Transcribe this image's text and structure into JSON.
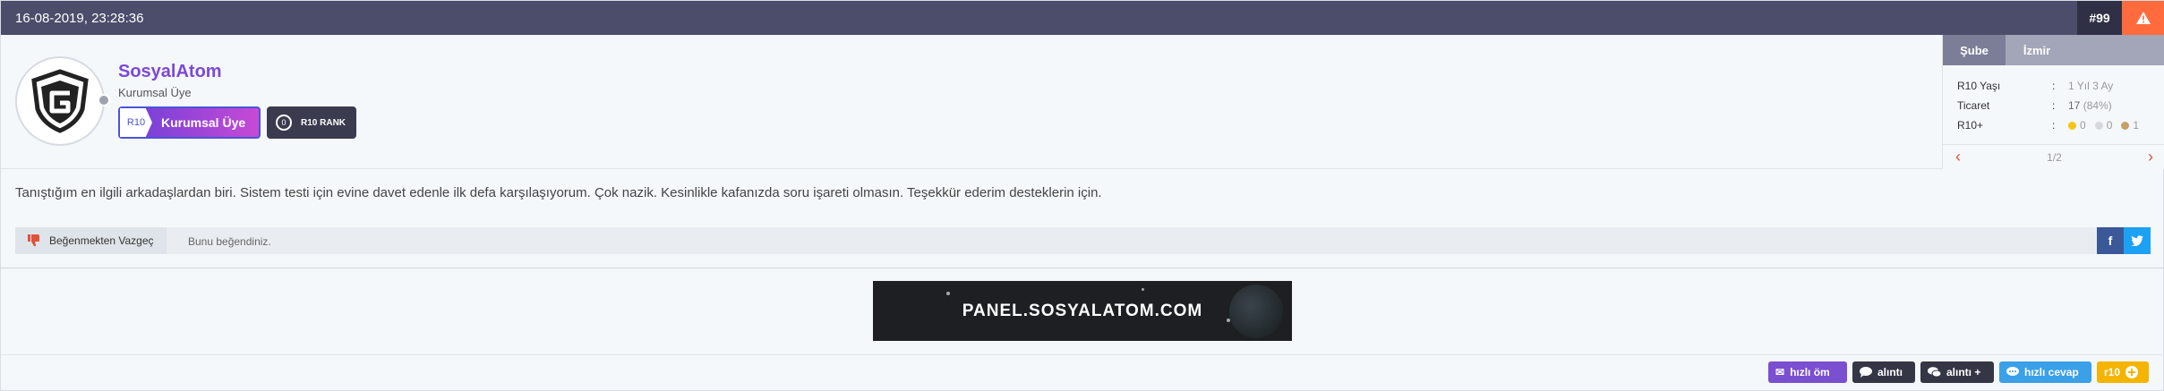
{
  "header": {
    "date": "16-08-2019, 23:28:36",
    "post_number": "#99",
    "report_icon": "warning-icon"
  },
  "user": {
    "name": "SosyalAtom",
    "title": "Kurumsal Üye",
    "badge_primary": {
      "tag": "R10",
      "label": "Kurumsal Üye"
    },
    "badge_rank": {
      "count": "0",
      "label": "R10 RANK"
    }
  },
  "side": {
    "tabs": [
      "Şube",
      "İzmir"
    ],
    "stats": [
      {
        "key": "R10 Yaşı",
        "sep": ":",
        "value": "1 Yıl 3 Ay"
      },
      {
        "key": "Ticaret",
        "sep": ":",
        "value": "17",
        "extra": "(84%)"
      },
      {
        "key": "R10+",
        "sep": ":",
        "gold": "0",
        "silver": "0",
        "bronze": "1"
      }
    ],
    "pager": "1/2"
  },
  "post": {
    "text": "Tanıştığım en ilgili arkadaşlardan biri. Sistem testi için evine davet edenle ilk defa karşılaşıyorum. Çok nazik. Kesinlikle kafanızda soru işareti olmasın. Teşekkür ederim desteklerin için."
  },
  "like": {
    "button_label": "Beğenmekten Vazgeç",
    "status": "Bunu beğendiniz."
  },
  "share": {
    "facebook": "f",
    "twitter": "t"
  },
  "banner": {
    "text": "PANEL.SOSYALATOM.COM"
  },
  "actions": [
    {
      "label": "hızlı öm",
      "icon": "mail-icon"
    },
    {
      "label": "alıntı",
      "icon": "chat-icon"
    },
    {
      "label": "alıntı +",
      "icon": "chats-icon"
    },
    {
      "label": "hızlı cevap",
      "icon": "reply-icon"
    },
    {
      "label": "r10",
      "icon": "plus-icon"
    }
  ],
  "colors": {
    "header": "#4b4d6a",
    "accent": "#7b49d6",
    "report": "#ff6b3d"
  }
}
